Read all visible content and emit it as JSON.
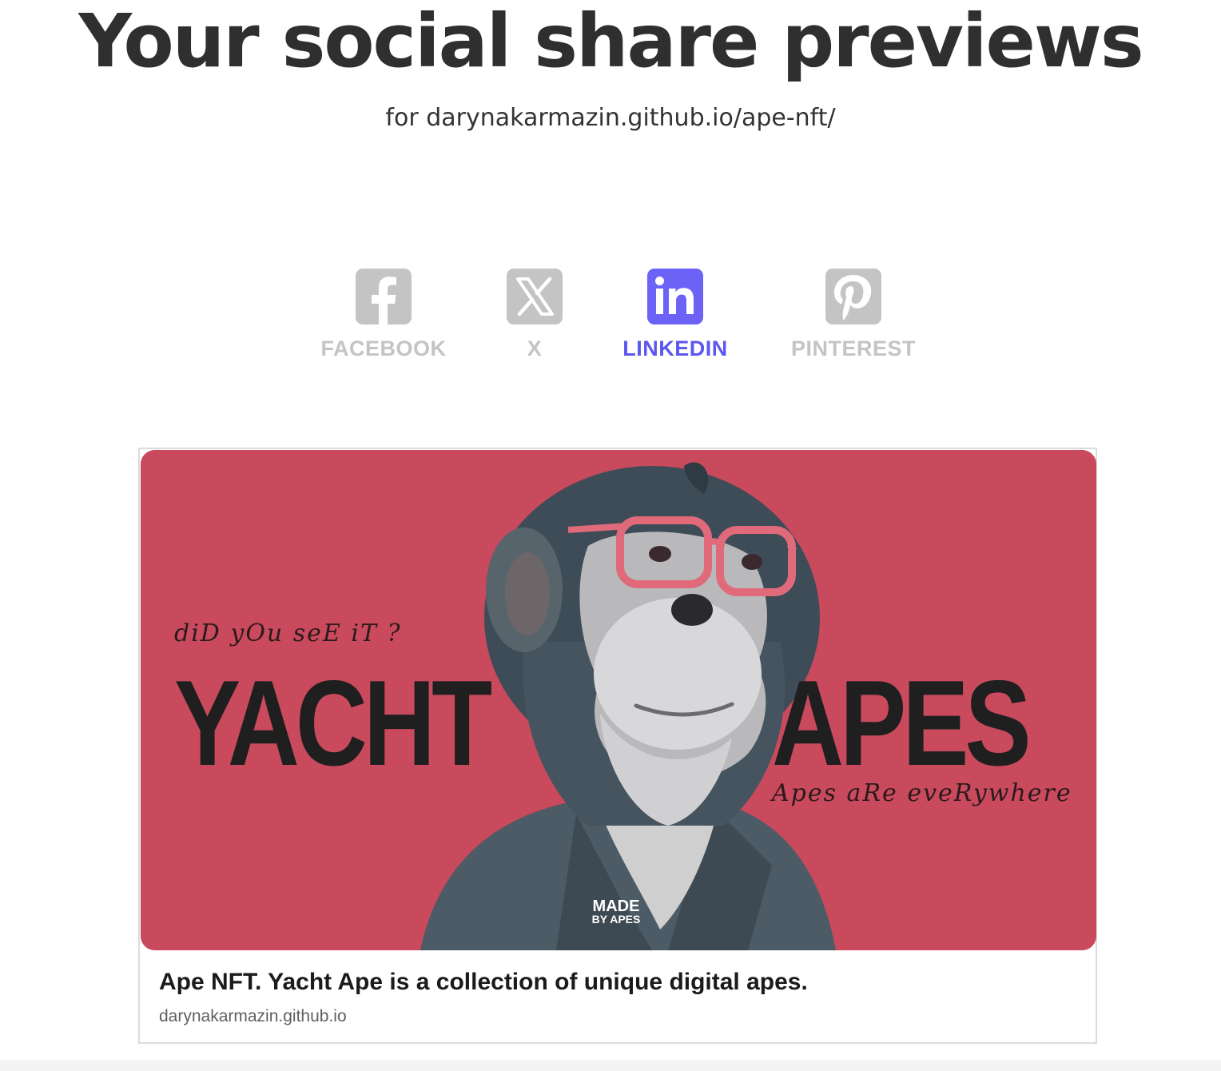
{
  "header": {
    "title": "Your social share previews",
    "subtitle": "for darynakarmazin.github.io/ape-nft/"
  },
  "tabs": [
    {
      "label": "FACEBOOK",
      "icon": "facebook-icon",
      "active": false
    },
    {
      "label": "X",
      "icon": "x-icon",
      "active": false
    },
    {
      "label": "LINKEDIN",
      "icon": "linkedin-icon",
      "active": true
    },
    {
      "label": "PINTEREST",
      "icon": "pinterest-icon",
      "active": false
    }
  ],
  "preview": {
    "image": {
      "tagline_top": "diD yOu seE iT ?",
      "word_left": "YACHT",
      "word_right": "APES",
      "tagline_bottom": "Apes aRe eveRywhere",
      "brand_line1": "MADE",
      "brand_line2": "BY APES"
    },
    "title": "Ape NFT. Yacht Ape is a collection of unique digital apes.",
    "domain": "darynakarmazin.github.io"
  },
  "colors": {
    "accent": "#6c63f6",
    "inactive": "#c4c4c4",
    "image_background": "#c94a5c"
  }
}
